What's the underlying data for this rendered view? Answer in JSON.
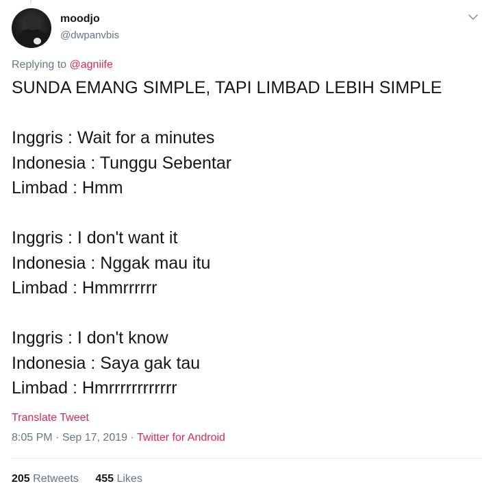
{
  "user": {
    "display_name": "moodjo",
    "handle": "@dwpanvbis",
    "avatar_icon": "profile-photo-avatar"
  },
  "reply": {
    "prefix": "Replying to",
    "mention": "@agniife"
  },
  "tweet": {
    "lines": [
      "SUNDA EMANG SIMPLE, TAPI LIMBAD LEBIH SIMPLE",
      "",
      "Inggris : Wait for a minutes",
      "Indonesia : Tunggu Sebentar",
      "Limbad : Hmm",
      "",
      "Inggris : I don't want it",
      "Indonesia : Nggak mau itu",
      "Limbad : Hmmrrrrrr",
      "",
      "Inggris : I don't know",
      "Indonesia : Saya gak tau",
      "Limbad : Hmrrrrrrrrrrrr"
    ]
  },
  "translate_label": "Translate Tweet",
  "meta": {
    "time": "8:05 PM",
    "date": "Sep 17, 2019",
    "separator": "·",
    "source": "Twitter for Android"
  },
  "stats": {
    "retweets_count": "205",
    "retweets_label": "Retweets",
    "likes_count": "455",
    "likes_label": "Likes"
  },
  "colors": {
    "accent": "#e0245e",
    "secondary_text": "#657786",
    "primary_text": "#14171a",
    "divider": "#e6ecf0"
  },
  "icons": {
    "menu": "chevron-down-icon"
  }
}
